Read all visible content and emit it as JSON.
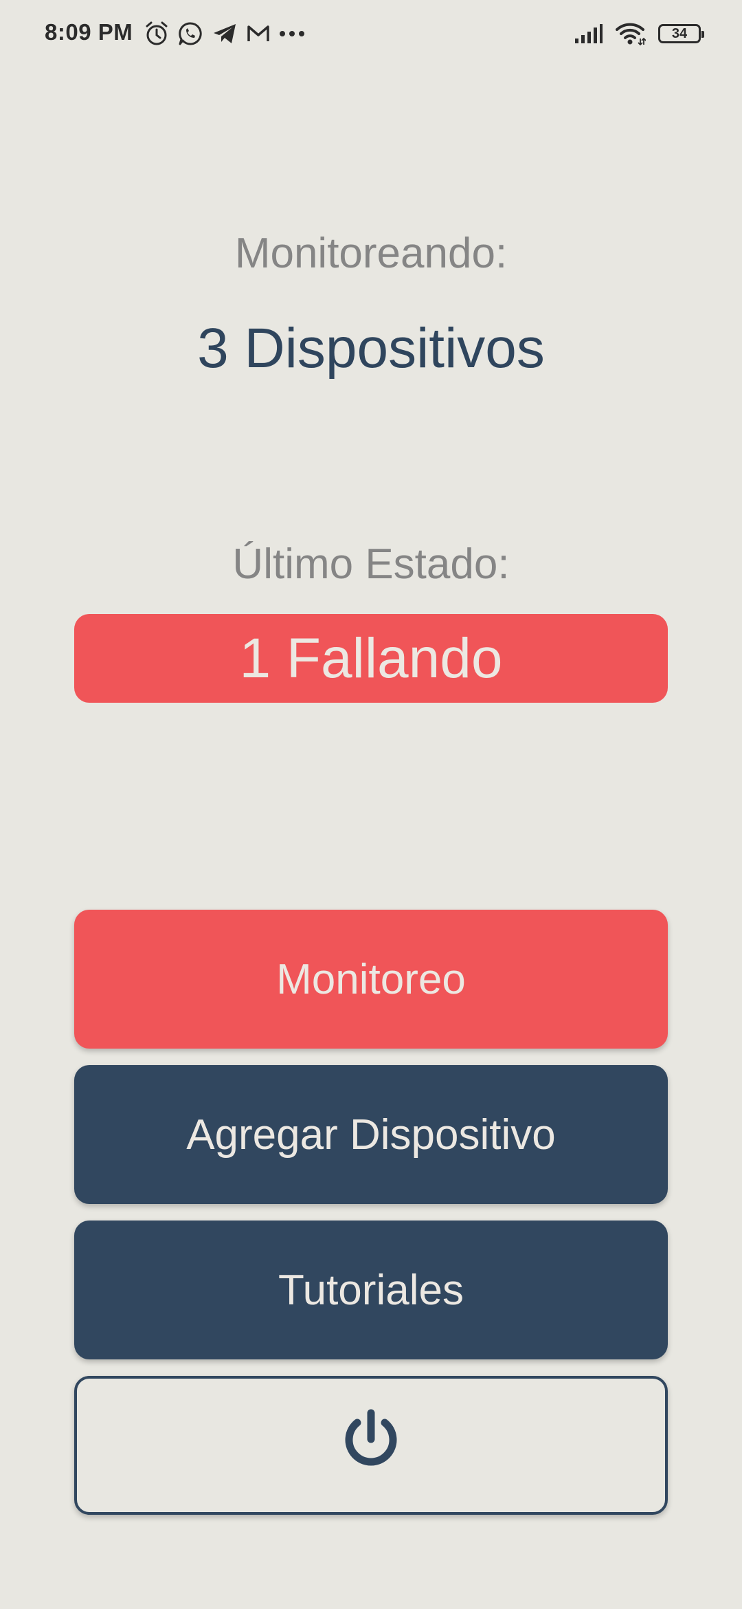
{
  "status_bar": {
    "time": "8:09 PM",
    "left_icons": [
      "alarm-icon",
      "whatsapp-icon",
      "telegram-icon",
      "gmail-icon",
      "more-notifications-icon"
    ],
    "right_icons": [
      "signal-icon",
      "wifi-icon",
      "battery-icon"
    ],
    "battery_level": "34"
  },
  "main": {
    "monitoring_label": "Monitoreando:",
    "device_count": "3 Dispositivos",
    "last_state_label": "Último Estado:",
    "status_text": "1 Fallando"
  },
  "buttons": {
    "monitor": "Monitoreo",
    "add_device": "Agregar Dispositivo",
    "tutorials": "Tutoriales",
    "power_icon": "power-icon"
  },
  "colors": {
    "background": "#e8e7e1",
    "alert_red": "#f05558",
    "navy": "#31475f",
    "gray_text": "#858585",
    "light_text": "#ece8e2"
  }
}
